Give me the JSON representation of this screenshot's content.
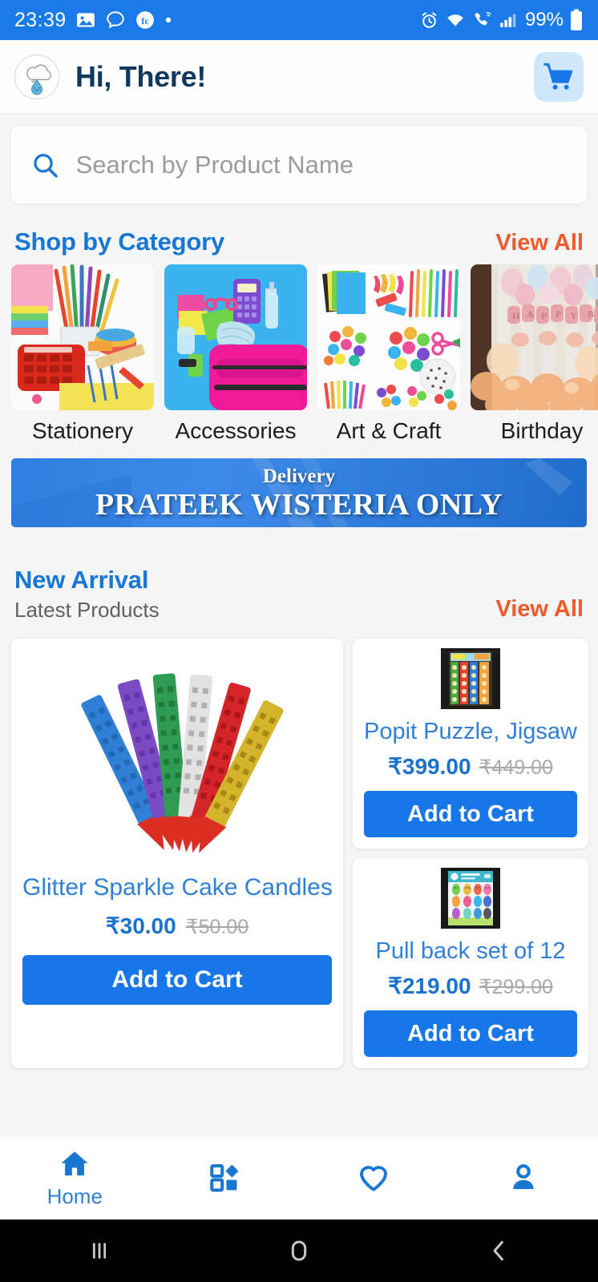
{
  "status_bar": {
    "time": "23:39",
    "battery_percent": "99%",
    "left_icons": [
      "image-icon",
      "chat-bubble-icon",
      "fc-app-icon",
      "dot-icon"
    ],
    "right_icons": [
      "alarm-icon",
      "wifi-icon",
      "wifi-calling-icon",
      "signal-icon",
      "battery-icon"
    ],
    "background_color": "#1a7ae8"
  },
  "app_bar": {
    "avatar_icon": "cloud-raindrop-logo",
    "greeting": "Hi, There!",
    "cart_icon": "shopping-cart-icon",
    "cart_bg_color": "#cfe6fb"
  },
  "search": {
    "placeholder": "Search by Product Name",
    "value": "",
    "icon": "search-icon"
  },
  "category_section": {
    "title": "Shop by Category",
    "view_all": "View All",
    "title_color": "#1877d2",
    "view_all_color": "#f1592a",
    "items": [
      {
        "label": "Stationery",
        "image": "stationery-supplies-photo"
      },
      {
        "label": "Accessories",
        "image": "backpack-accessories-photo"
      },
      {
        "label": "Art & Craft",
        "image": "art-craft-supplies-photo"
      },
      {
        "label": "Birthday",
        "image": "birthday-decoration-photo"
      }
    ]
  },
  "banner": {
    "subtitle": "Delivery",
    "title": "PRATEEK WISTERIA ONLY",
    "background_color": "#2f7fe0"
  },
  "new_arrival": {
    "title": "New Arrival",
    "subtitle": "Latest Products",
    "view_all": "View All"
  },
  "products": {
    "featured": {
      "name": "Glitter Sparkle Cake Candles for",
      "price": "₹30.00",
      "old_price": "₹50.00",
      "button": "Add to Cart",
      "image": "glitter-candles-photo"
    },
    "side": [
      {
        "name": "Popit Puzzle, Jigsaw",
        "price": "₹399.00",
        "old_price": "₹449.00",
        "button": "Add to Cart",
        "image": "popit-puzzle-photo"
      },
      {
        "name": "Pull back set of 12",
        "price": "₹219.00",
        "old_price": "₹299.00",
        "button": "Add to Cart",
        "image": "pullback-toys-photo"
      }
    ]
  },
  "bottom_nav": {
    "items": [
      {
        "label": "Home",
        "icon": "home-icon",
        "active": true
      },
      {
        "label": "",
        "icon": "categories-grid-icon",
        "active": false
      },
      {
        "label": "",
        "icon": "heart-icon",
        "active": false
      },
      {
        "label": "",
        "icon": "person-icon",
        "active": false
      }
    ],
    "accent_color": "#1877d2"
  },
  "android_nav": {
    "recents": "recents-icon",
    "home": "home-pill-icon",
    "back": "back-chevron-icon"
  }
}
